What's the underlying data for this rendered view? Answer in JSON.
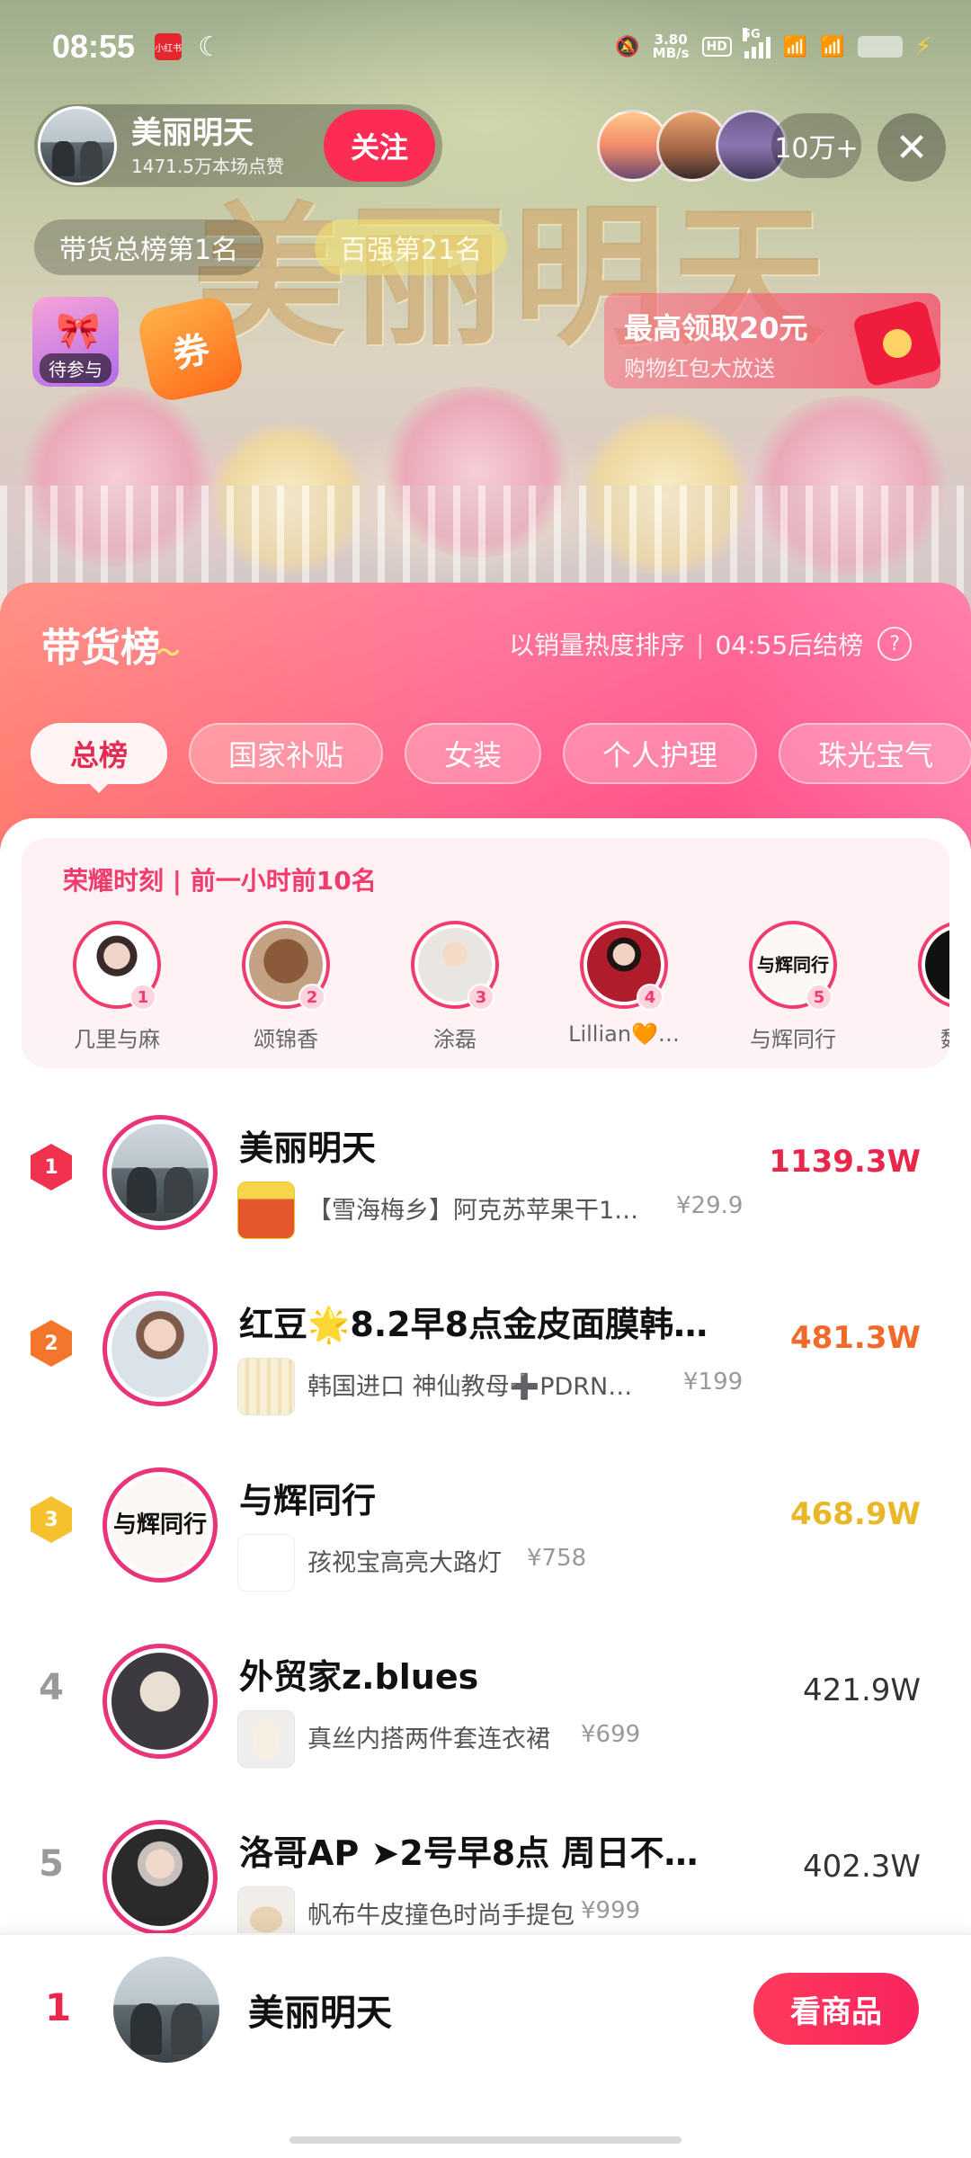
{
  "status_bar": {
    "time": "08:55",
    "app_badge": "小红书",
    "net_speed_value": "3.80",
    "net_speed_unit": "MB/s",
    "hd": "HD",
    "network": "5G"
  },
  "streamer": {
    "name": "美丽明天",
    "likes": "1471.5万本场点赞",
    "follow_label": "关注",
    "viewer_count": "10万+",
    "total_rank_label": "带货总榜第1名",
    "top100_label": "百强第21名",
    "pending_label": "待参与",
    "coupon_label": "券",
    "redpacket_title": "最高领取20元",
    "redpacket_subtitle": "购物红包大放送",
    "stream_title_text": "美丽明天"
  },
  "board": {
    "title": "带货榜",
    "sort_text": "以销量热度排序",
    "countdown": "04:55后结榜",
    "tabs": [
      {
        "label": "总榜"
      },
      {
        "label": "国家补贴"
      },
      {
        "label": "女装"
      },
      {
        "label": "个人护理"
      },
      {
        "label": "珠光宝气"
      }
    ]
  },
  "honor": {
    "title": "荣耀时刻 | 前一小时前10名",
    "items": [
      {
        "rank": "1",
        "name": "几里与麻"
      },
      {
        "rank": "2",
        "name": "颂锦香"
      },
      {
        "rank": "3",
        "name": "涂磊"
      },
      {
        "rank": "4",
        "name": "Lillian🧡…"
      },
      {
        "rank": "5",
        "name": "与辉同行"
      },
      {
        "rank": "",
        "name": "魏哥"
      }
    ]
  },
  "rankings": [
    {
      "rank": "1",
      "name": "美丽明天",
      "product": "【雪海梅乡】阿克苏苹果干1…",
      "price": "¥29.9",
      "score": "1139.3W"
    },
    {
      "rank": "2",
      "name": "红豆🌟8.2早8点金皮面膜韩…",
      "product": "韩国进口 神仙教母➕PDRN…",
      "price": "¥199",
      "score": "481.3W"
    },
    {
      "rank": "3",
      "name": "与辉同行",
      "product": "孩视宝高亮大路灯",
      "price": "¥758",
      "score": "468.9W"
    },
    {
      "rank": "4",
      "name": "外贸家z.blues",
      "product": "真丝内搭两件套连衣裙",
      "price": "¥699",
      "score": "421.9W"
    },
    {
      "rank": "5",
      "name": "洛哥AP ➤2号早8点 周日不…",
      "product": "帆布牛皮撞色时尚手提包",
      "price": "¥999",
      "score": "402.3W"
    }
  ],
  "calligraphy_avatar_text": "与辉同行",
  "my_rank": {
    "rank": "1",
    "name": "美丽明天",
    "button_label": "看商品"
  }
}
